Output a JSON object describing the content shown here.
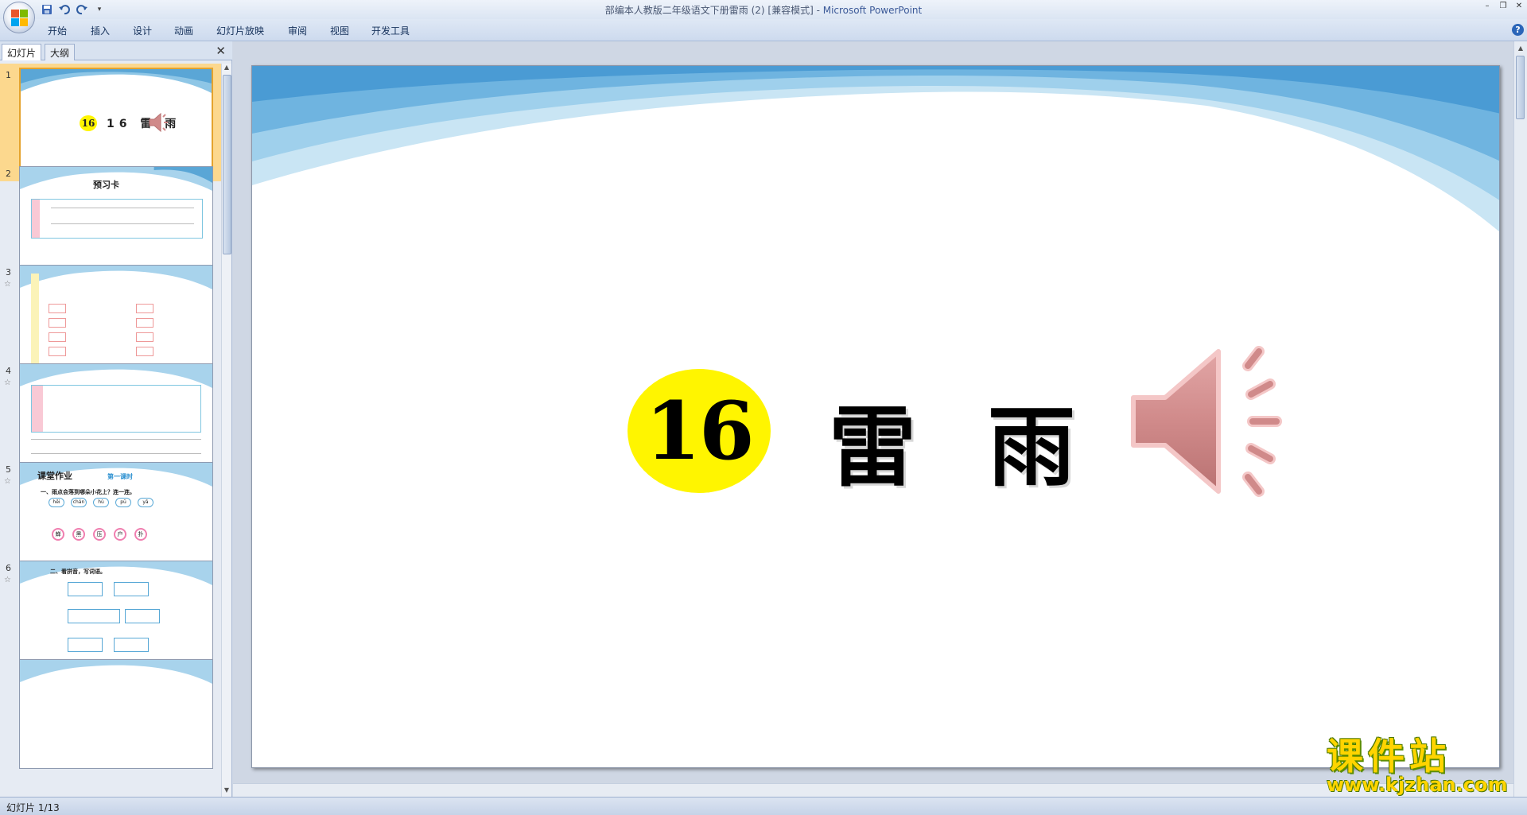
{
  "window": {
    "title": "部编本人教版二年级语文下册雷雨 (2) [兼容模式] - ",
    "app_name": "Microsoft PowerPoint"
  },
  "ribbon": {
    "tabs": [
      "开始",
      "插入",
      "设计",
      "动画",
      "幻灯片放映",
      "审阅",
      "视图",
      "开发工具"
    ]
  },
  "left_pane": {
    "tabs": [
      "幻灯片",
      "大纲"
    ],
    "thumbnails": [
      {
        "num": "1",
        "label": "16 雷 雨"
      },
      {
        "num": "2",
        "label": "预习卡"
      },
      {
        "num": "3",
        "label": ""
      },
      {
        "num": "4",
        "label": ""
      },
      {
        "num": "5",
        "label": "课堂作业",
        "sub": "第一课时",
        "question": "一、雨点会落到哪朵小花上？连一连。",
        "pinyin": [
          "hēi",
          "chán",
          "hù",
          "pū",
          "yā"
        ],
        "chars": [
          "蝉",
          "黑",
          "压",
          "户",
          "扑"
        ]
      },
      {
        "num": "6",
        "label": "二、看拼音，写词语。"
      }
    ]
  },
  "slide": {
    "number": "16",
    "title_char_1": "雷",
    "title_char_2": "雨"
  },
  "watermark": {
    "big": "课件站",
    "small": "www.kjzhan.com"
  },
  "status": {
    "slide_counter": "幻灯片 1/13"
  },
  "colors": {
    "yellow": "#fff500",
    "speaker": "#d08a8a",
    "wave": "#7db9de"
  }
}
